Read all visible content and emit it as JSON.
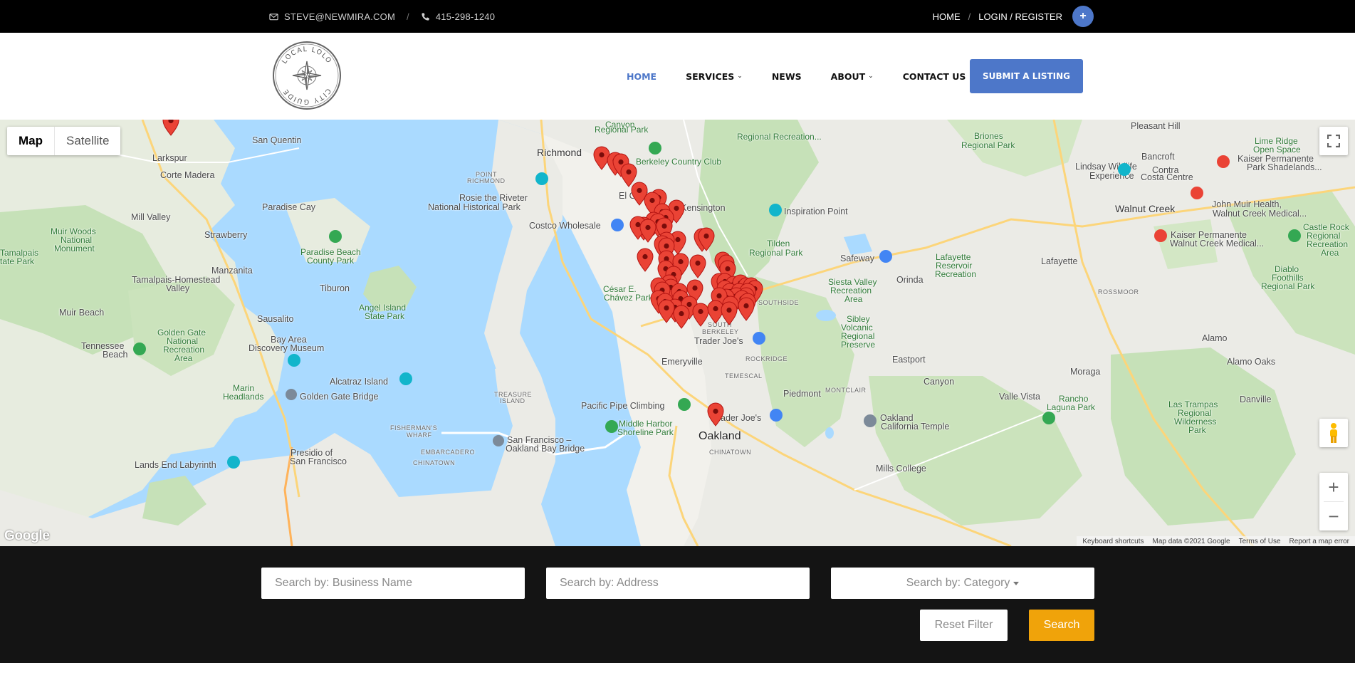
{
  "topbar": {
    "email": "STEVE@NEWMIRA.COM",
    "phone": "415-298-1240",
    "home": "HOME",
    "login": "LOGIN / REGISTER",
    "plus": "+"
  },
  "logo": {
    "text_top": "LOCAL LOLO",
    "text_bottom": "CITY GUIDE"
  },
  "nav": {
    "items": [
      {
        "label": "HOME",
        "active": true
      },
      {
        "label": "SERVICES",
        "dropdown": true
      },
      {
        "label": "NEWS"
      },
      {
        "label": "ABOUT",
        "dropdown": true
      },
      {
        "label": "CONTACT US"
      }
    ],
    "submit": "SUBMIT A LISTING"
  },
  "map": {
    "type_buttons": [
      "Map",
      "Satellite"
    ],
    "zoom_in": "+",
    "zoom_out": "−",
    "google": "Google",
    "attribution": [
      "Keyboard shortcuts",
      "Map data ©2021 Google",
      "Terms of Use",
      "Report a map error"
    ],
    "labels": {
      "canyon": "Canyon",
      "regional_park": "Regional Park",
      "regional_rec": "Regional Recreation...",
      "briones": "Briones",
      "briones_park": "Regional Park",
      "pleasant_hill": "Pleasant Hill",
      "larkspur": "Larkspur",
      "san_quentin": "San Quentin",
      "richmond": "Richmond",
      "berkeley_cc": "Berkeley Country Club",
      "lime_ridge": "Lime Ridge",
      "open_space": "Open Space",
      "bancroft": "Bancroft",
      "kaiser_shadelands": "Kaiser Permanente",
      "park_shadelands": "Park Shadelands...",
      "corte_madera": "Corte Madera",
      "point_richmond_1": "POINT",
      "point_richmond_2": "RICHMOND",
      "lindsay_1": "Lindsay Wildlife",
      "lindsay_2": "Experience",
      "contra": "Contra",
      "costa_centre": "Costa Centre",
      "el_cerrito": "El Cerrito",
      "rosie_1": "Rosie the Riveter",
      "rosie_2": "National Historical Park",
      "paradise_cay": "Paradise Cay",
      "kensington": "Kensington",
      "inspiration_point": "Inspiration Point",
      "walnut_creek": "Walnut Creek",
      "john_muir_1": "John Muir Health,",
      "john_muir_2": "Walnut Creek Medical...",
      "mill_valley": "Mill Valley",
      "costco": "Costco Wholesale",
      "muir_woods_1": "Muir Woods",
      "muir_woods_2": "National",
      "muir_woods_3": "Monument",
      "strawberry": "Strawberry",
      "tilden_1": "Tilden",
      "tilden_2": "Regional Park",
      "kaiser_wc_1": "Kaiser Permanente",
      "kaiser_wc_2": "Walnut Creek Medical...",
      "castle_rock_1": "Castle Rock",
      "castle_rock_2": "Regional",
      "castle_rock_3": "Recreation",
      "castle_rock_4": "Area",
      "tamalpais_1": "Tamalpais",
      "tamalpais_2": "tate Park",
      "paradise_beach_1": "Paradise Beach",
      "paradise_beach_2": "County Park",
      "safeway": "Safeway",
      "lafayette_res_1": "Lafayette",
      "lafayette_res_2": "Reservoir",
      "lafayette_res_3": "Recreation",
      "lafayette": "Lafayette",
      "manzanita": "Manzanita",
      "tam_homestead_1": "Tamalpais-Homestead",
      "tam_homestead_2": "Valley",
      "tiburon": "Tiburon",
      "cesar_1": "César E.",
      "cesar_2": "Chávez Park",
      "orinda": "Orinda",
      "siesta_1": "Siesta Valley",
      "siesta_2": "Recreation",
      "siesta_3": "Area",
      "rossmoor": "ROSSMOOR",
      "diablo_1": "Diablo",
      "diablo_2": "Foothills",
      "diablo_3": "Regional Park",
      "angel_1": "Angel Island",
      "angel_2": "State Park",
      "muir_beach": "Muir Beach",
      "sausalito": "Sausalito",
      "southside": "SOUTHSIDE",
      "south_berkeley_1": "SOUTH",
      "south_berkeley_2": "BERKELEY",
      "sibley_1": "Sibley",
      "sibley_2": "Volcanic",
      "sibley_3": "Regional",
      "sibley_4": "Preserve",
      "gg_nra_1": "Golden Gate",
      "gg_nra_2": "National",
      "gg_nra_3": "Recreation",
      "gg_nra_4": "Area",
      "bay_area_1": "Bay Area",
      "bay_area_2": "Discovery Museum",
      "trader_joes": "Trader Joe's",
      "rockridge": "ROCKRIDGE",
      "alamo": "Alamo",
      "tennessee_1": "Tennessee",
      "tennessee_2": "Beach",
      "emeryville": "Emeryville",
      "eastport": "Eastport",
      "alamo_oaks": "Alamo Oaks",
      "alcatraz": "Alcatraz Island",
      "temescal": "TEMESCAL",
      "canyon_town": "Canyon",
      "moraga": "Moraga",
      "marin_1": "Marin",
      "marin_2": "Headlands",
      "ggb": "Golden Gate Bridge",
      "treasure_1": "TREASURE",
      "treasure_2": "ISLAND",
      "piedmont": "Piedmont",
      "montclair": "MONTCLAIR",
      "valle_vista": "Valle Vista",
      "rancho_1": "Rancho",
      "rancho_2": "Laguna Park",
      "danville": "Danville",
      "pacific_pipe": "Pacific Pipe Climbing",
      "oakland_temple_1": "Oakland",
      "oakland_temple_2": "California Temple",
      "las_trampas_1": "Las Trampas",
      "las_trampas_2": "Regional",
      "las_trampas_3": "Wilderness",
      "las_trampas_4": "Park",
      "middle_harbor_1": "Middle Harbor",
      "middle_harbor_2": "Shoreline Park",
      "trader_joes_2": "ader Joe's",
      "fishermans_1": "FISHERMAN'S",
      "fishermans_2": "WHARF",
      "sf_oak_1": "San Francisco –",
      "sf_oak_2": "Oakland Bay Bridge",
      "oakland": "Oakland",
      "presidio_1": "Presidio of",
      "presidio_2": "San Francisco",
      "embarcadero": "EMBARCADERO",
      "chinatown_sf": "CHINATOWN",
      "chinatown_oak": "CHINATOWN",
      "lands_end": "Lands End Labyrinth",
      "mills_college": "Mills College"
    }
  },
  "search": {
    "business_placeholder": "Search by: Business Name",
    "address_placeholder": "Search by: Address",
    "category_placeholder": "Search by: Category",
    "reset": "Reset Filter",
    "search": "Search"
  },
  "colors": {
    "accent": "#4d77c9",
    "search_button": "#f0a30a",
    "marker": "#ea4335"
  }
}
